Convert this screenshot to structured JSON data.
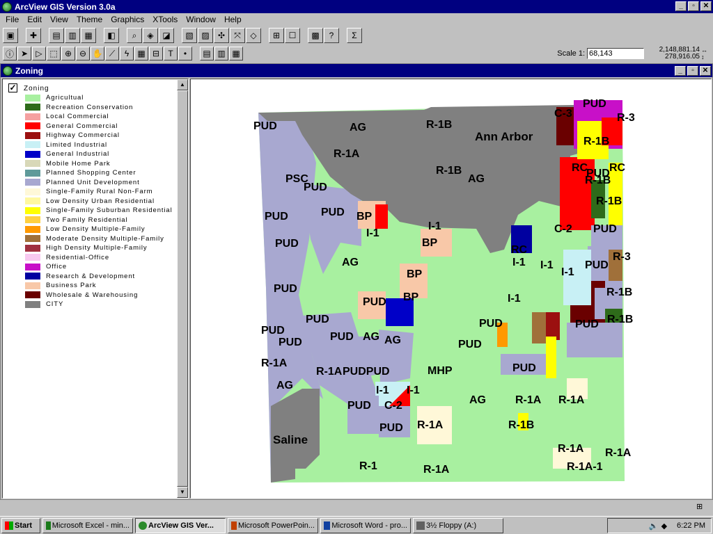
{
  "window": {
    "title": "ArcView GIS Version 3.0a"
  },
  "menu": [
    "File",
    "Edit",
    "View",
    "Theme",
    "Graphics",
    "XTools",
    "Window",
    "Help"
  ],
  "scale": {
    "label": "Scale 1:",
    "value": "68,143",
    "x": "2,148,881.14",
    "y": "278,916.05"
  },
  "view": {
    "title": "Zoning"
  },
  "layer": {
    "name": "Zoning",
    "visible": true
  },
  "legend": [
    {
      "label": "Agricultual",
      "color": "#a8f0a0"
    },
    {
      "label": "Recreation Conservation",
      "color": "#2e6b1a"
    },
    {
      "label": "Local Commercial",
      "color": "#f5a0a0"
    },
    {
      "label": "General Commercial",
      "color": "#ff0000"
    },
    {
      "label": "Highway Commercial",
      "color": "#9b1010"
    },
    {
      "label": "Limited Industrial",
      "color": "#c8f0f5"
    },
    {
      "label": "General Industrial",
      "color": "#0000c8"
    },
    {
      "label": "Mobile Home Park",
      "color": "#d8d8b8"
    },
    {
      "label": "Planned Shopping Center",
      "color": "#5f9a9a"
    },
    {
      "label": "Planned Unit Development",
      "color": "#a8a8d0"
    },
    {
      "label": "Single-Family Rural Non-Farm",
      "color": "#fff8d8"
    },
    {
      "label": "Low Density Urban Residential",
      "color": "#fff8a0"
    },
    {
      "label": "Single-Family Suburban Residential",
      "color": "#ffff00"
    },
    {
      "label": "Two Family Residential",
      "color": "#ffd040"
    },
    {
      "label": "Low Density Multiple-Family",
      "color": "#ff9900"
    },
    {
      "label": "Moderate Density Multiple-Family",
      "color": "#a0703a"
    },
    {
      "label": "High Density Multiple-Family",
      "color": "#a03040"
    },
    {
      "label": "Residential-Office",
      "color": "#f8c8f0"
    },
    {
      "label": "Office",
      "color": "#c810c8"
    },
    {
      "label": "Research & Development",
      "color": "#0000a0"
    },
    {
      "label": "Business Park",
      "color": "#f8c8a8"
    },
    {
      "label": "Wholesale & Warehousing",
      "color": "#6a0000"
    },
    {
      "label": "CITY",
      "color": "#808080"
    }
  ],
  "map_labels": [
    "PUD",
    "AG",
    "R-1B",
    "Ann Arbor",
    "C-3",
    "PUD",
    "R-3",
    "R-1A",
    "R-1B",
    "PUD",
    "R-1B",
    "AG",
    "RC",
    "RC",
    "PSC",
    "PUD",
    "R-1B",
    "R-1B",
    "PUD",
    "PUD",
    "BP",
    "I-1",
    "C-2",
    "PUD",
    "I-1",
    "BP",
    "PUD",
    "RC",
    "AG",
    "I-1",
    "I-1",
    "PUD",
    "R-3",
    "BP",
    "I-1",
    "PUD",
    "PUD",
    "BP",
    "I-1",
    "R-1B",
    "PUD",
    "PUD",
    "R-1B",
    "PUD",
    "PUD",
    "AG",
    "PUD",
    "AG",
    "PUD",
    "PUD",
    "R-1A",
    "R-1A",
    "PUDPUD",
    "MHP",
    "PUD",
    "AG",
    "I-1",
    "I-1",
    "AG",
    "R-1A",
    "R-1A",
    "PUD",
    "C-2",
    "PUD",
    "R-1A",
    "R-1B",
    "Saline",
    "R-1A",
    "R-1A",
    "R-1",
    "R-1A",
    "R-1A-1"
  ],
  "taskbar": {
    "start": "Start",
    "items": [
      "Microsoft Excel - min...",
      "ArcView GIS Ver...",
      "Microsoft PowerPoin...",
      "Microsoft Word - pro...",
      "3½ Floppy (A:)"
    ],
    "clock": "6:22 PM"
  },
  "colors": {
    "titlebar": "#000080",
    "city": "#808080",
    "pud": "#a8a8d0",
    "ag": "#a8f0a0"
  }
}
